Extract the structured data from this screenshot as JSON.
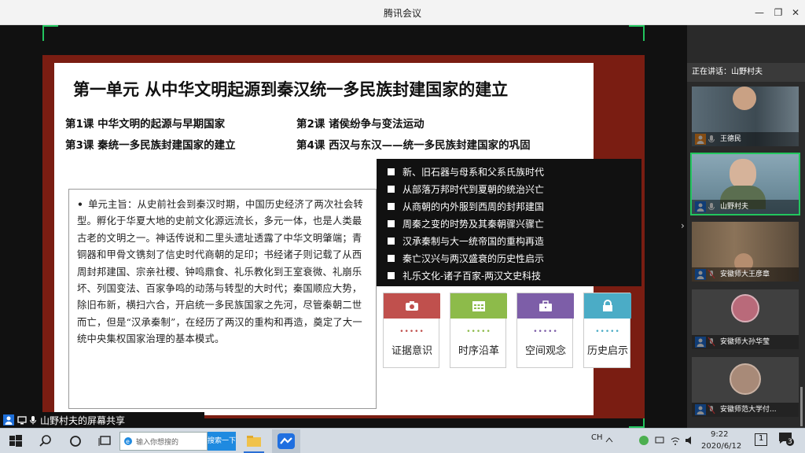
{
  "window": {
    "title": "腾讯会议"
  },
  "slide": {
    "title": "第一单元 从中华文明起源到秦汉统一多民族封建国家的建立",
    "lessons": [
      "第1课 中华文明的起源与早期国家",
      "第2课 诸侯纷争与变法运动",
      "第3课 秦统一多民族封建国家的建立",
      "第4课 西汉与东汉——统一多民族封建国家的巩固"
    ],
    "summary": {
      "bullet": "•",
      "text": "单元主旨：从史前社会到秦汉时期，中国历史经济了两次社会转型。孵化于华夏大地的史前文化源远流长，多元一体，也是人类最古老的文明之一。神话传说和二里头遗址透露了中华文明肇端；青铜器和甲骨文镌刻了信史时代商朝的足印；书经诸子则记载了从西周封邦建国、宗亲社稷、钟鸣鼎食、礼乐教化到王室衰微、礼崩乐坏、列国变法、百家争鸣的动荡与转型的大时代；秦国顺应大势，除旧布新，横扫六合，开启统一多民族国家之先河，尽管秦朝二世而亡，但是“汉承秦制”，在经历了两汉的重构和再造，奠定了大一统中央集权国家治理的基本模式。"
    },
    "topics": [
      "新、旧石器与母系和父系氏族时代",
      "从部落万邦时代到夏朝的统治兴亡",
      "从商朝的内外服到西周的封邦建国",
      "周秦之变的时势及其秦朝骤兴骤亡",
      "汉承秦制与大一统帝国的重构再造",
      "秦亡汉兴与两汉盛衰的历史性启示",
      "礼乐文化-诸子百家-两汉文史科技"
    ],
    "cards": [
      {
        "label": "证据意识",
        "dots": "•••••",
        "color": "#c0504d",
        "icon": "camera-icon"
      },
      {
        "label": "时序沿革",
        "dots": "•••••",
        "color": "#8dbb4a",
        "icon": "calendar-icon"
      },
      {
        "label": "空间观念",
        "dots": "•••••",
        "color": "#7d5ea8",
        "icon": "briefcase-icon"
      },
      {
        "label": "历史启示",
        "dots": "•••••",
        "color": "#4bacc6",
        "icon": "lock-icon"
      }
    ]
  },
  "share": {
    "label": "山野村夫的屏幕共享"
  },
  "sidebar": {
    "speaking": "正在讲话：山野村夫",
    "participants": [
      {
        "name": "王德民"
      },
      {
        "name": "山野村夫"
      },
      {
        "name": "安徽师大王彦章"
      },
      {
        "name": "安徽师大孙华莹"
      },
      {
        "name": "安徽师范大学付..."
      }
    ]
  },
  "taskbar": {
    "search_placeholder": "输入你想搜的",
    "search_button": "搜索一下",
    "ime": "CH",
    "time": "9:22",
    "date": "2020/6/12",
    "notif_count": "3",
    "desktop_badge": "1"
  }
}
